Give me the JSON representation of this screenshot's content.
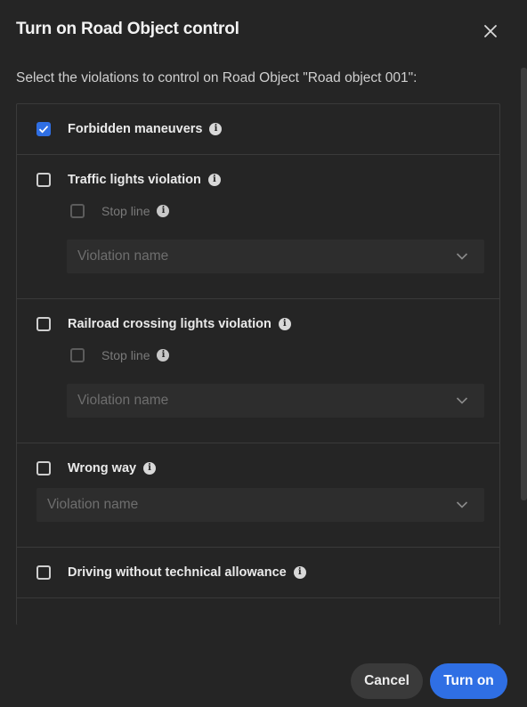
{
  "dialog": {
    "title": "Turn on Road Object control",
    "subtitle": "Select the violations to control on Road Object \"Road object 001\":",
    "close_icon": "close-icon",
    "accent_color": "#2f6fe4"
  },
  "violations": {
    "forbidden": {
      "label": "Forbidden maneuvers",
      "checked": true
    },
    "traffic_lights": {
      "label": "Traffic lights violation",
      "checked": false,
      "stop_line_label": "Stop line",
      "select_placeholder": "Violation name"
    },
    "railroad": {
      "label": "Railroad crossing lights violation",
      "checked": false,
      "stop_line_label": "Stop line",
      "select_placeholder": "Violation name"
    },
    "wrong_way": {
      "label": "Wrong way",
      "checked": false,
      "select_placeholder": "Violation name"
    },
    "technical": {
      "label": "Driving without technical allowance",
      "checked": false
    }
  },
  "footer": {
    "cancel_label": "Cancel",
    "turn_on_label": "Turn on"
  }
}
